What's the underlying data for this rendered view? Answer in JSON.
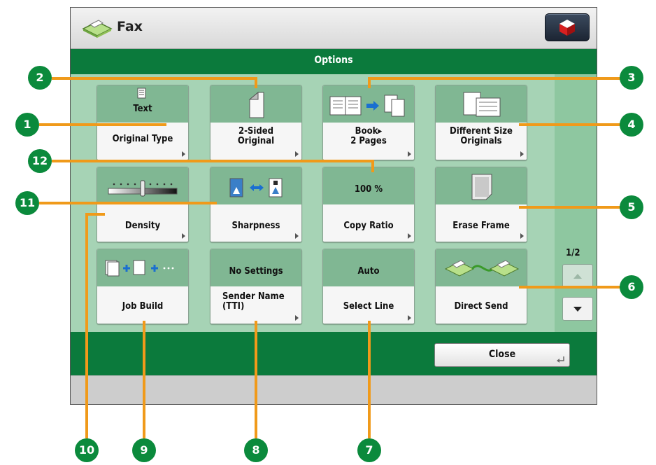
{
  "header": {
    "title": "Fax"
  },
  "options_bar": {
    "title": "Options"
  },
  "buttons": [
    {
      "setting": "Text",
      "label": "Original Type"
    },
    {
      "setting": "",
      "label": "2-Sided\nOriginal"
    },
    {
      "setting": "",
      "label": "Book▸\n2 Pages"
    },
    {
      "setting": "",
      "label": "Different Size\nOriginals"
    },
    {
      "setting": "",
      "label": "Density",
      "density_level": 0.5
    },
    {
      "setting": "",
      "label": "Sharpness"
    },
    {
      "setting": "100 %",
      "label": "Copy Ratio"
    },
    {
      "setting": "",
      "label": "Erase Frame"
    },
    {
      "setting": "",
      "label": "Job Build"
    },
    {
      "setting": "No Settings",
      "label": "Sender Name\n(TTI)"
    },
    {
      "setting": "Auto",
      "label": "Select Line"
    },
    {
      "setting": "",
      "label": "Direct Send"
    }
  ],
  "pager": {
    "page": "1/2"
  },
  "close_button": {
    "label": "Close"
  },
  "callouts": [
    "1",
    "2",
    "3",
    "4",
    "5",
    "6",
    "7",
    "8",
    "9",
    "10",
    "11",
    "12"
  ],
  "colors": {
    "green": "#0b7a3c",
    "callout": "#0b8a3c",
    "leader": "#f09a1a"
  }
}
